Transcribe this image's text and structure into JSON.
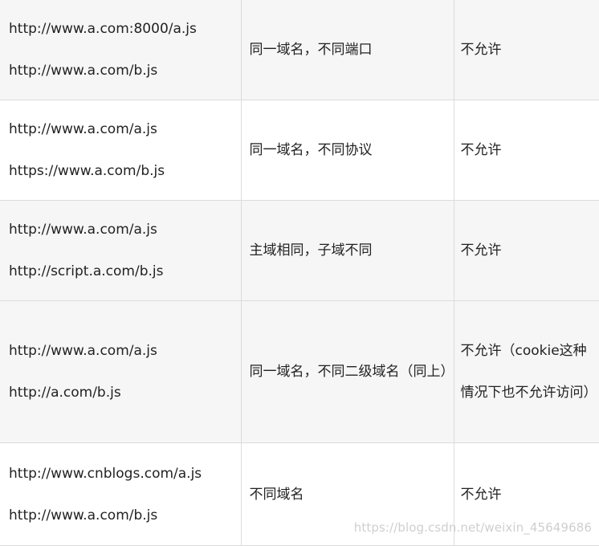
{
  "rows": [
    {
      "url_a": "http://www.a.com:8000/a.js",
      "url_b": "http://www.a.com/b.js",
      "description": "同一域名，不同端口",
      "result": "不允许"
    },
    {
      "url_a": "http://www.a.com/a.js",
      "url_b": "https://www.a.com/b.js",
      "description": "同一域名，不同协议",
      "result": "不允许"
    },
    {
      "url_a": "http://www.a.com/a.js",
      "url_b": "http://script.a.com/b.js",
      "description": "主域相同，子域不同",
      "result": "不允许"
    },
    {
      "url_a": "http://www.a.com/a.js",
      "url_b": "http://a.com/b.js",
      "description": "同一域名，不同二级域名（同上）",
      "result": "不允许（cookie这种情况下也不允许访问）"
    },
    {
      "url_a": "http://www.cnblogs.com/a.js",
      "url_b": "http://www.a.com/b.js",
      "description": "不同域名",
      "result": "不允许"
    }
  ],
  "watermark": "https://blog.csdn.net/weixin_45649686"
}
